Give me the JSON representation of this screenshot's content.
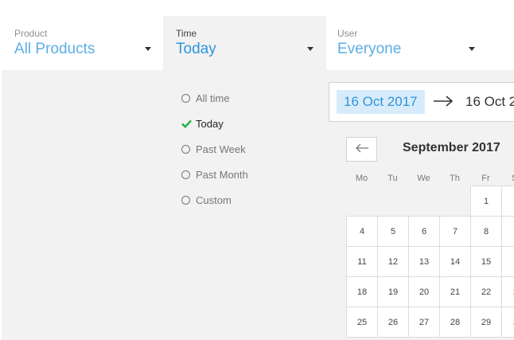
{
  "filters": {
    "product": {
      "label": "Product",
      "value": "All Products"
    },
    "time": {
      "label": "Time",
      "value": "Today"
    },
    "user": {
      "label": "User",
      "value": "Everyone"
    }
  },
  "time_options": [
    {
      "label": "All time",
      "selected": false
    },
    {
      "label": "Today",
      "selected": true
    },
    {
      "label": "Past Week",
      "selected": false
    },
    {
      "label": "Past Month",
      "selected": false
    },
    {
      "label": "Custom",
      "selected": false
    }
  ],
  "range": {
    "from": "16 Oct 2017",
    "to": "16 Oct 2"
  },
  "calendar": {
    "month_title": "September 2017",
    "weekdays": [
      "Mo",
      "Tu",
      "We",
      "Th",
      "Fr",
      "S"
    ],
    "weeks": [
      [
        "",
        "",
        "",
        "",
        "1",
        ""
      ],
      [
        "4",
        "5",
        "6",
        "7",
        "8",
        ""
      ],
      [
        "11",
        "12",
        "13",
        "14",
        "15",
        "1"
      ],
      [
        "18",
        "19",
        "20",
        "21",
        "22",
        "2"
      ],
      [
        "25",
        "26",
        "27",
        "28",
        "29",
        "3"
      ]
    ]
  },
  "colors": {
    "accent": "#2f95dc",
    "accent_light": "#5aaee6",
    "selected_bg": "#d8ebfa",
    "check": "#27b44a",
    "panel_bg": "#f2f2f2"
  },
  "icons": {
    "caret": "chevron-down-icon",
    "check": "check-icon",
    "arrow": "arrow-right-icon",
    "prev": "arrow-left-icon"
  }
}
